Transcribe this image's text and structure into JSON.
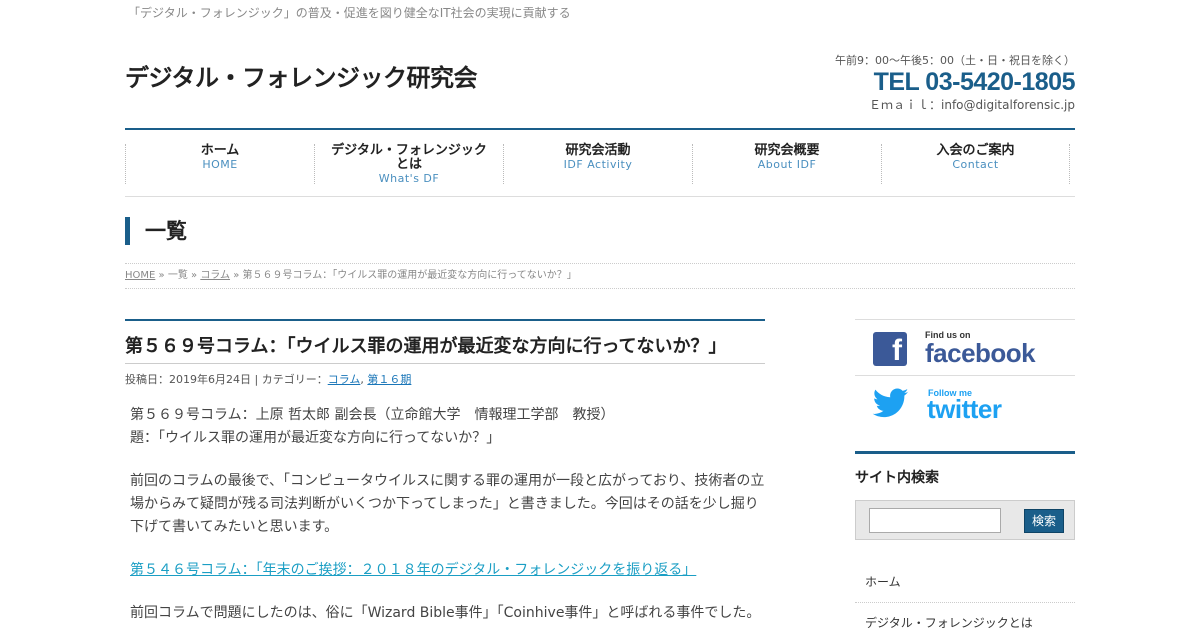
{
  "header": {
    "tagline": "「デジタル・フォレンジック」の普及・促進を図り健全なIT社会の実現に貢献する",
    "site_title": "デジタル・フォレンジック研究会",
    "hours": "午前9：00～午後5：00（土・日・祝日を除く）",
    "tel": "TEL 03-5420-1805",
    "email": "Ｅｍａｉｌ：info@digitalforensic.jp"
  },
  "nav": {
    "items": [
      {
        "jp": "ホーム",
        "en": "HOME"
      },
      {
        "jp": "デジタル・フォレンジックとは",
        "en": "What's DF"
      },
      {
        "jp": "研究会活動",
        "en": "IDF Activity"
      },
      {
        "jp": "研究会概要",
        "en": "About IDF"
      },
      {
        "jp": "入会のご案内",
        "en": "Contact"
      }
    ]
  },
  "page": {
    "heading": "一覧"
  },
  "breadcrumb": {
    "home": "HOME",
    "sep1": " » ",
    "list": "一覧",
    "sep2": " » ",
    "category": "コラム",
    "sep3": " » ",
    "current": "第５６９号コラム：「ウイルス罪の運用が最近変な方向に行ってないか？」"
  },
  "article": {
    "title": "第５６９号コラム：「ウイルス罪の運用が最近変な方向に行ってないか？」",
    "meta_prefix": "投稿日：2019年6月24日 | カテゴリー：",
    "cat1": "コラム",
    "cat_sep": ", ",
    "cat2": "第１６期",
    "line1": "第５６９号コラム：上原 哲太郎 副会長（立命館大学　情報理工学部　教授）",
    "line2": "題：「ウイルス罪の運用が最近変な方向に行ってないか？」",
    "para1": "前回のコラムの最後で、「コンピュータウイルスに関する罪の運用が一段と広がっており、技術者の立場からみて疑問が残る司法判断がいくつか下ってしまった」と書きました。今回はその話を少し掘り下げて書いてみたいと思います。",
    "link": "第５４６号コラム：「年末のご挨拶：２０１８年のデジタル・フォレンジックを振り返る」",
    "para2": "前回コラムで問題にしたのは、俗に「Wizard Bible事件」「Coinhive事件」と呼ばれる事件でした。"
  },
  "sidebar": {
    "facebook_small": "Find us on",
    "facebook_big": "facebook",
    "twitter_small": "Follow me",
    "twitter_big": "twitter",
    "search_heading": "サイト内検索",
    "search_button": "検索",
    "search_value": "",
    "menu": [
      "ホーム",
      "デジタル・フォレンジックとは"
    ]
  },
  "colors": {
    "accent": "#1a5e8a",
    "link": "#1a9ec4",
    "facebook": "#3b5998",
    "twitter": "#1da1f2"
  }
}
